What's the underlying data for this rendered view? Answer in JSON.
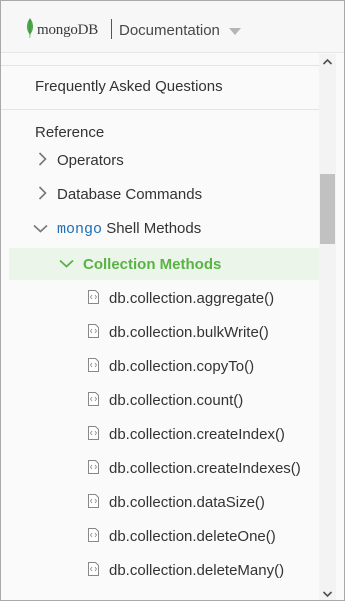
{
  "header": {
    "brand": "mongoDB",
    "section_title": "Documentation",
    "brand_color": "#4fa94d"
  },
  "nav": {
    "faq_label": "Frequently Asked Questions",
    "reference_label": "Reference",
    "items": [
      {
        "label": "Operators",
        "state": "collapsed"
      },
      {
        "label": "Database Commands",
        "state": "collapsed"
      },
      {
        "label_code": "mongo",
        "label": "Shell Methods",
        "state": "expanded"
      }
    ],
    "selected": {
      "label": "Collection Methods",
      "state": "expanded",
      "color": "#59b344"
    },
    "methods": [
      "db.collection.aggregate()",
      "db.collection.bulkWrite()",
      "db.collection.copyTo()",
      "db.collection.count()",
      "db.collection.createIndex()",
      "db.collection.createIndexes()",
      "db.collection.dataSize()",
      "db.collection.deleteOne()",
      "db.collection.deleteMany()"
    ]
  },
  "icons": {
    "logo": "mongodb-leaf-icon",
    "menu_caret": "caret-down-icon",
    "collapsed": "chevron-right-icon",
    "expanded": "chevron-down-icon",
    "page": "document-icon",
    "scroll_up": "scroll-up-arrow-icon",
    "scroll_down": "scroll-down-arrow-icon"
  }
}
